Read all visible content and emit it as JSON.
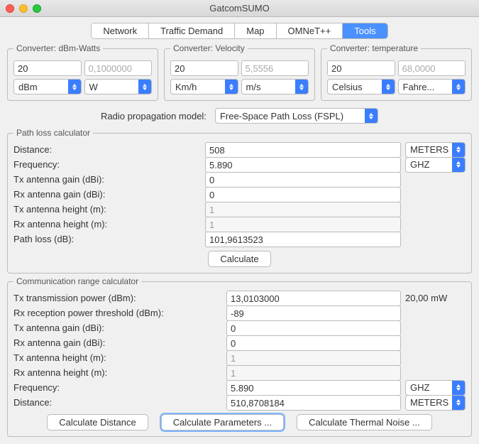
{
  "title": "GatcomSUMO",
  "tabs": [
    "Network",
    "Traffic Demand",
    "Map",
    "OMNeT++",
    "Tools"
  ],
  "active_tab": "Tools",
  "converters": {
    "dbm_watts": {
      "legend": "Converter: dBm-Watts",
      "val1": "20",
      "val2": "0,1000000",
      "unit1": "dBm",
      "unit2": "W"
    },
    "velocity": {
      "legend": "Converter: Velocity",
      "val1": "20",
      "val2": "5,5556",
      "unit1": "Km/h",
      "unit2": "m/s"
    },
    "temperature": {
      "legend": "Converter: temperature",
      "val1": "20",
      "val2": "68,0000",
      "unit1": "Celsius",
      "unit2": "Fahre..."
    }
  },
  "model_label": "Radio propagation model:",
  "model_value": "Free-Space Path Loss (FSPL)",
  "pathloss": {
    "legend": "Path loss calculator",
    "rows": {
      "distance": {
        "lbl": "Distance:",
        "val": "508",
        "unit": "METERS"
      },
      "frequency": {
        "lbl": "Frequency:",
        "val": "5.890",
        "unit": "GHZ"
      },
      "txgain": {
        "lbl": "Tx antenna gain (dBi):",
        "val": "0"
      },
      "rxgain": {
        "lbl": "Rx antenna gain (dBi):",
        "val": "0"
      },
      "txheight": {
        "lbl": "Tx antenna height (m):",
        "val": "1"
      },
      "rxheight": {
        "lbl": "Rx antenna height (m):",
        "val": "1"
      },
      "loss": {
        "lbl": "Path loss (dB):",
        "val": "101,9613523"
      }
    },
    "calc_btn": "Calculate"
  },
  "commrange": {
    "legend": "Communication range calculator",
    "rows": {
      "txpower": {
        "lbl": "Tx transmission power (dBm):",
        "val": "13,0103000",
        "note": "20,00 mW"
      },
      "rxthresh": {
        "lbl": "Rx reception power threshold (dBm):",
        "val": "-89"
      },
      "txgain": {
        "lbl": "Tx antenna gain (dBi):",
        "val": "0"
      },
      "rxgain": {
        "lbl": "Rx antenna gain (dBi):",
        "val": "0"
      },
      "txheight": {
        "lbl": "Tx antenna height (m):",
        "val": "1"
      },
      "rxheight": {
        "lbl": "Rx antenna height (m):",
        "val": "1"
      },
      "frequency": {
        "lbl": "Frequency:",
        "val": "5.890",
        "unit": "GHZ"
      },
      "distance": {
        "lbl": "Distance:",
        "val": "510,8708184",
        "unit": "METERS"
      }
    },
    "btn_dist": "Calculate Distance",
    "btn_params": "Calculate Parameters ...",
    "btn_thermal": "Calculate Thermal Noise ..."
  }
}
